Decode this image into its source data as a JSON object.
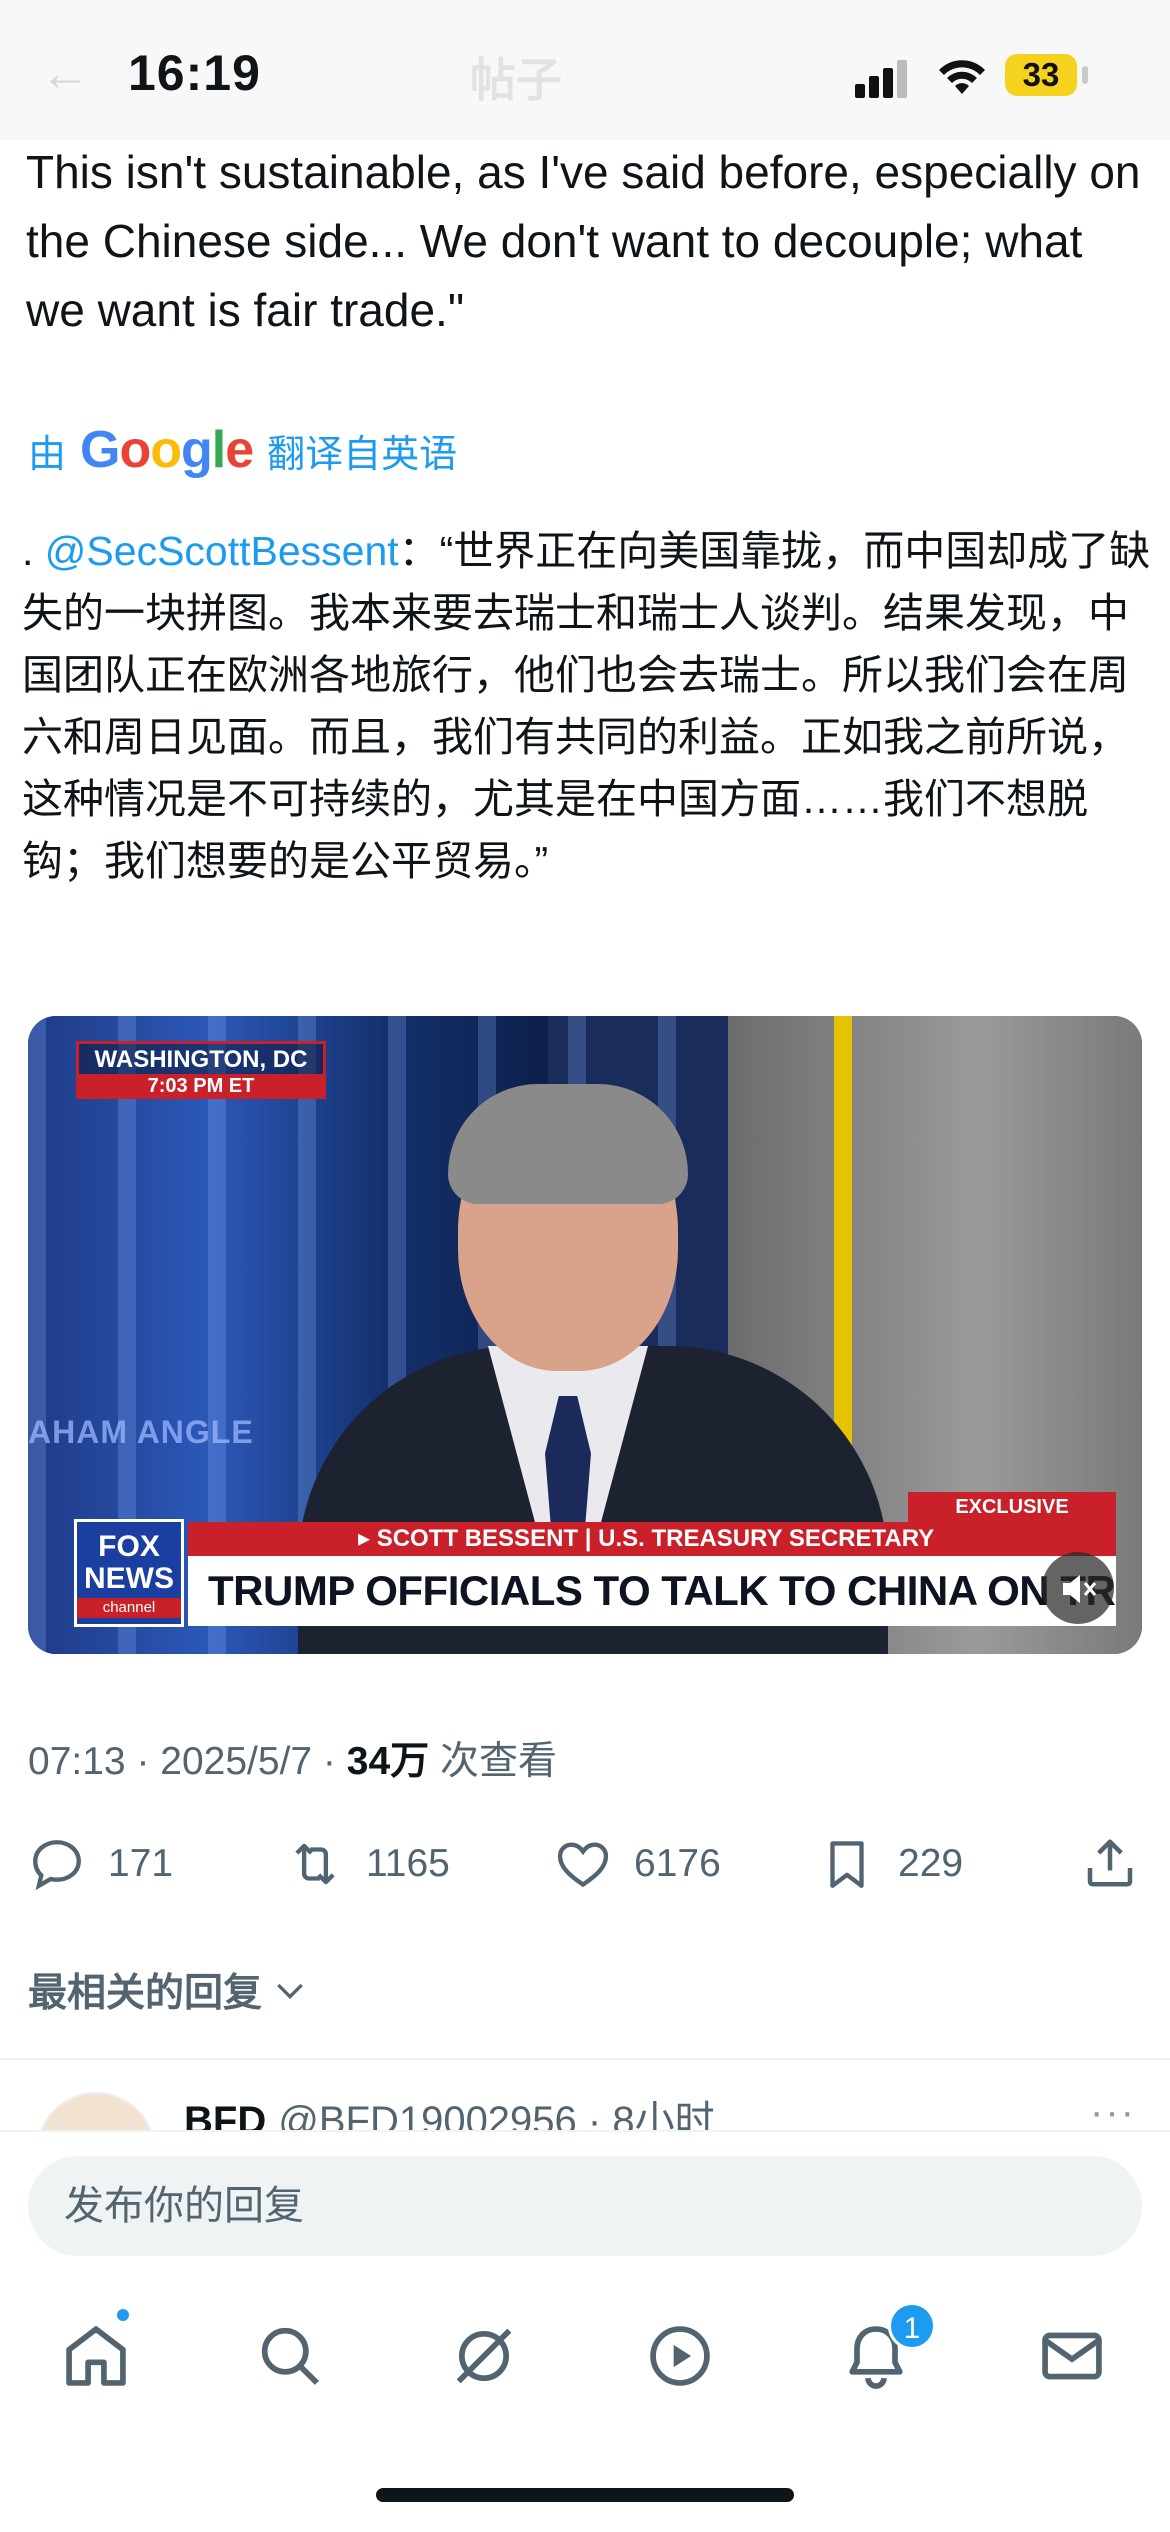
{
  "status_bar": {
    "time": "16:19",
    "battery": "33",
    "back_ghost": "←",
    "title_ghost": "帖子",
    "icons": [
      "signal-icon",
      "wifi-icon",
      "battery-icon"
    ]
  },
  "tweet": {
    "english_text": "This isn't sustainable, as I've said before, especially on the Chinese side... We don't want to decouple; what we want is fair trade.\"",
    "translated_by_prefix": "由",
    "translated_by_suffix": "翻译自英语",
    "google": [
      "G",
      "o",
      "o",
      "g",
      "l",
      "e"
    ],
    "cn_prefix": ". ",
    "mention": "@SecScottBessent",
    "cn_text": "：“世界正在向美国靠拢，而中国却成了缺失的一块拼图。我本来要去瑞士和瑞士人谈判。结果发现，中国团队正在欧洲各地旅行，他们也会去瑞士。所以我们会在周六和周日见面。而且，我们有共同的利益。正如我之前所说，这种情况是不可持续的，尤其是在中国方面……我们不想脱钩；我们想要的是公平贸易。”"
  },
  "video": {
    "location": "WASHINGTON, DC",
    "local_time": "7:03 PM ET",
    "show_fragment": "AHAM ANGLE",
    "exclusive": "EXCLUSIVE",
    "logo_line1": "FOX",
    "logo_line2": "NEWS",
    "logo_line3": "channel",
    "name_bar": "▸ SCOTT BESSENT | U.S. TREASURY SECRETARY",
    "headline": "TRUMP OFFICIALS TO TALK TO CHINA ON TRADE",
    "mute_icon": "🔇"
  },
  "meta": {
    "time": "07:13",
    "sep": " · ",
    "date": "2025/5/7",
    "views": "34万",
    "views_label": " 次查看"
  },
  "actions": {
    "replies": "171",
    "reposts": "1165",
    "likes": "6176",
    "bookmarks": "229"
  },
  "replies_section": {
    "sort_label": "最相关的回复"
  },
  "reply": {
    "name": "BFD",
    "handle_time": "@BFD19002956 · 8小时",
    "more": "···"
  },
  "compose": {
    "placeholder": "发布你的回复"
  },
  "tabbar": {
    "items": [
      "home-icon",
      "search-icon",
      "grok-icon",
      "video-icon",
      "notifications-icon",
      "messages-icon"
    ],
    "notification_count": "1"
  },
  "colors": {
    "accent": "#1d9bf0",
    "text": "#0f1419",
    "muted": "#536471"
  }
}
